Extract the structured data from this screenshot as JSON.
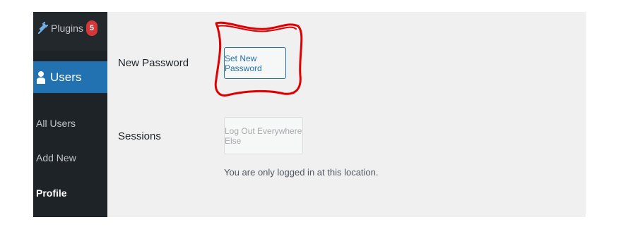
{
  "sidebar": {
    "plugins": {
      "label": "Plugins",
      "badge": "5",
      "icon": "plug-icon"
    },
    "users": {
      "label": "Users",
      "icon": "user-icon"
    },
    "submenu": [
      {
        "label": "All Users"
      },
      {
        "label": "Add New"
      },
      {
        "label": "Profile"
      }
    ]
  },
  "main": {
    "new_password": {
      "label": "New Password",
      "button": "Set New Password"
    },
    "sessions": {
      "label": "Sessions",
      "button": "Log Out Everywhere Else",
      "description": "You are only logged in at this location."
    }
  },
  "colors": {
    "sidebar_bg": "#1d2327",
    "accent": "#2271b1",
    "badge": "#d63638",
    "annotation": "#e00000"
  }
}
